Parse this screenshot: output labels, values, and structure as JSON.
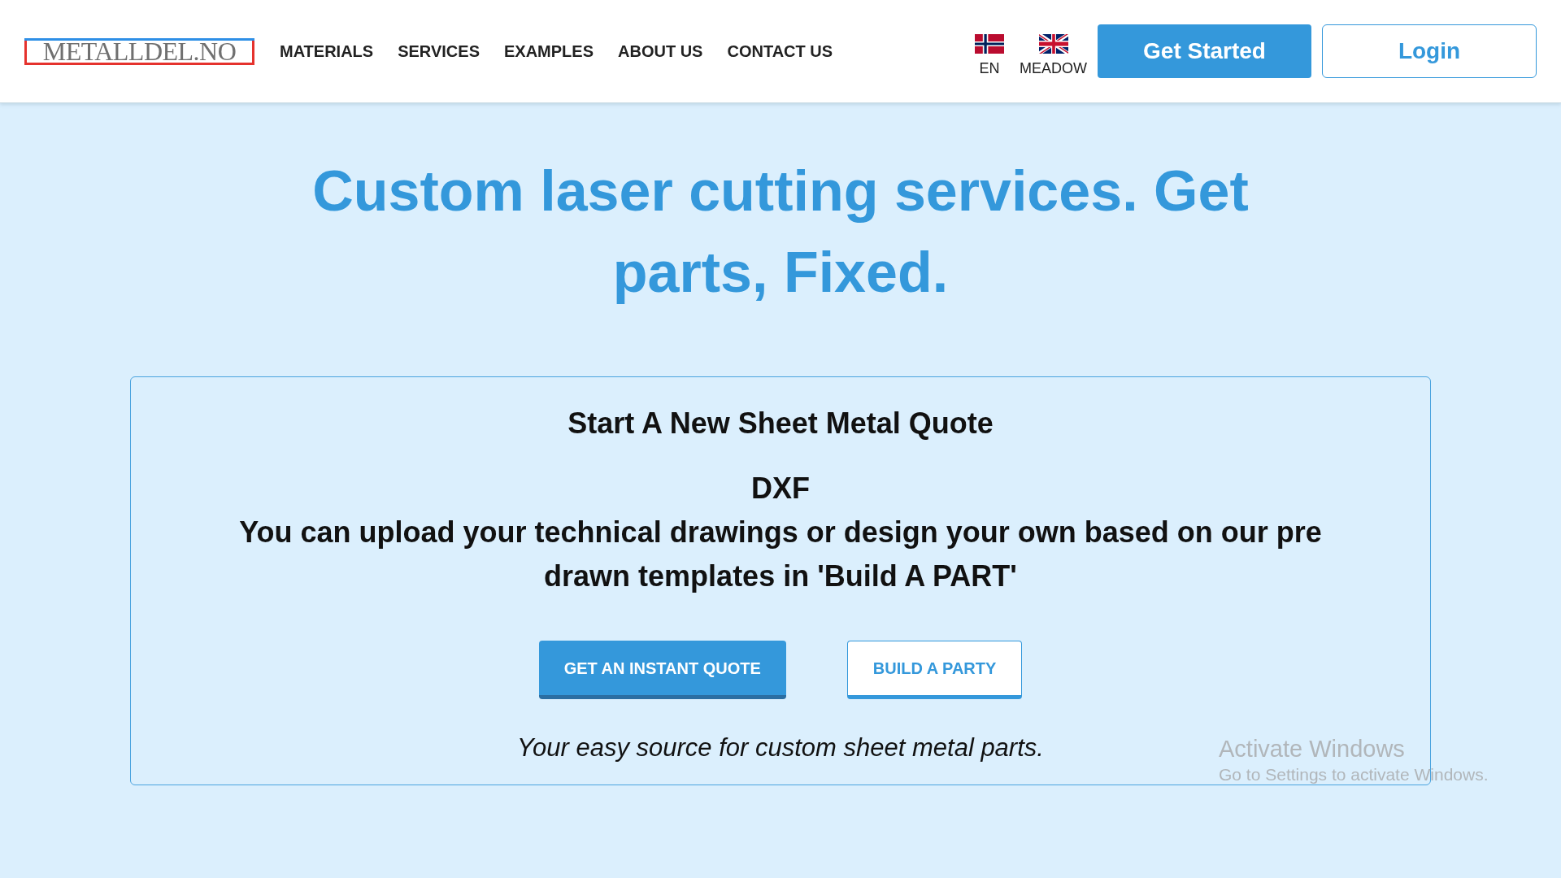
{
  "header": {
    "logo": "METALLDEL.NO",
    "nav": [
      "MATERIALS",
      "SERVICES",
      "EXAMPLES",
      "ABOUT US",
      "CONTACT US"
    ],
    "languages": [
      {
        "label": "EN",
        "kind": "norway"
      },
      {
        "label": "MEADOW",
        "kind": "britain"
      }
    ],
    "buttons": [
      {
        "label": "Get Started",
        "kind": "solid"
      },
      {
        "label": "Login",
        "kind": "outline"
      }
    ]
  },
  "hero": {
    "title": "Custom laser cutting services. Get parts, Fixed."
  },
  "quote_card": {
    "title": "Start A New Sheet Metal Quote",
    "format": "DXF",
    "description": "You can upload your technical drawings or design your own based on our pre drawn templates in 'Build A PART'",
    "buttons": [
      {
        "label": "GET AN INSTANT QUOTE",
        "kind": "solid"
      },
      {
        "label": "BUILD A PARTY",
        "kind": "outline"
      }
    ],
    "tagline": "Your easy source for custom sheet metal parts."
  },
  "os_notice": {
    "title": "Activate Windows",
    "subtitle": "Go to Settings to activate Windows."
  }
}
